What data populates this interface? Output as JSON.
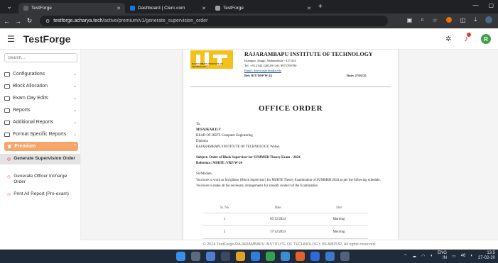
{
  "browser": {
    "tabs": [
      {
        "title": "TestForge",
        "active": true,
        "favicon_color": "#5f6368"
      },
      {
        "title": "Dashboard | Clerc.com",
        "active": false,
        "favicon_color": "#1a73e8"
      },
      {
        "title": "TestForge",
        "active": false,
        "favicon_color": "#9aa0a6"
      }
    ],
    "url_domain": "testforge.acharya.tech",
    "url_path": "/active/premium/v1/generate_supervision_order"
  },
  "app": {
    "brand": "TestForge",
    "avatar_letter": "R"
  },
  "sidebar": {
    "search_placeholder": "Search...",
    "items": [
      {
        "label": "Configurations"
      },
      {
        "label": "Block Allocation"
      },
      {
        "label": "Exam Day Edits"
      },
      {
        "label": "Reports"
      },
      {
        "label": "Additional Reports"
      },
      {
        "label": "Format Specific Reports"
      }
    ],
    "premium": {
      "label": "Premium",
      "sub_items": [
        {
          "label": "Generate Supervision Order",
          "active": true
        },
        {
          "label": "Generate Officer Incharge Order",
          "active": false
        },
        {
          "label": "Print All Report (Pre-exam)",
          "active": false
        }
      ]
    }
  },
  "document": {
    "institute": "RAJARAMBAPU INSTITUTE OF TECHNOLOGY",
    "address": "Islampur, Sangli, Maharashtra - 415 414",
    "tel": "Tel: +91 2342 220329   Cell: 8975700780",
    "email": "Email: director@ritindia.edu",
    "ref": "Ref: RIT/DSP/W-24",
    "date": "Date: 27/02/25",
    "logo_caption": "RAJARAMBAPU INSTITUTE OF TECHNOLOGY",
    "title": "OFFICE ORDER",
    "to": "To,",
    "name": "MISAJKAR D.V",
    "designation": "HEAD OF DEPT. Computer Engineering",
    "program": "Diploma",
    "institute_line": "RAJARAMBAPU INSTITUTE OF TECHNOLOGY, Walwa",
    "subject": "Subject: Order of Block Supervisor for SUMMER Theory Exam – 2024",
    "reference": "Reference: MSBTE /VKP/W-24",
    "salutation": "Sir/Madam,",
    "body": "You have to work as Invigilator (Block Supervisor) for MSBTE Theory Examination of SUMMER 2024 as per the following schedule. You have to make all the necessary arrangements for smooth conduct of the Examination.",
    "table": {
      "headers": [
        "Sr. No",
        "Date",
        "Slot"
      ],
      "rows": [
        [
          "1",
          "05/12/2024",
          "Morning"
        ],
        [
          "2",
          "17/12/2024",
          "Morning"
        ]
      ]
    }
  },
  "footer": "© 2024 TestForge-RAJARAMBAPU INSTITUTE OF TECHNOLOGY ISLAMPUR, All rights reserved.",
  "taskbar": {
    "lang_line1": "ENG",
    "lang_line2": "IN",
    "battery": "46",
    "time": "13:5",
    "date": "27-02-20"
  }
}
